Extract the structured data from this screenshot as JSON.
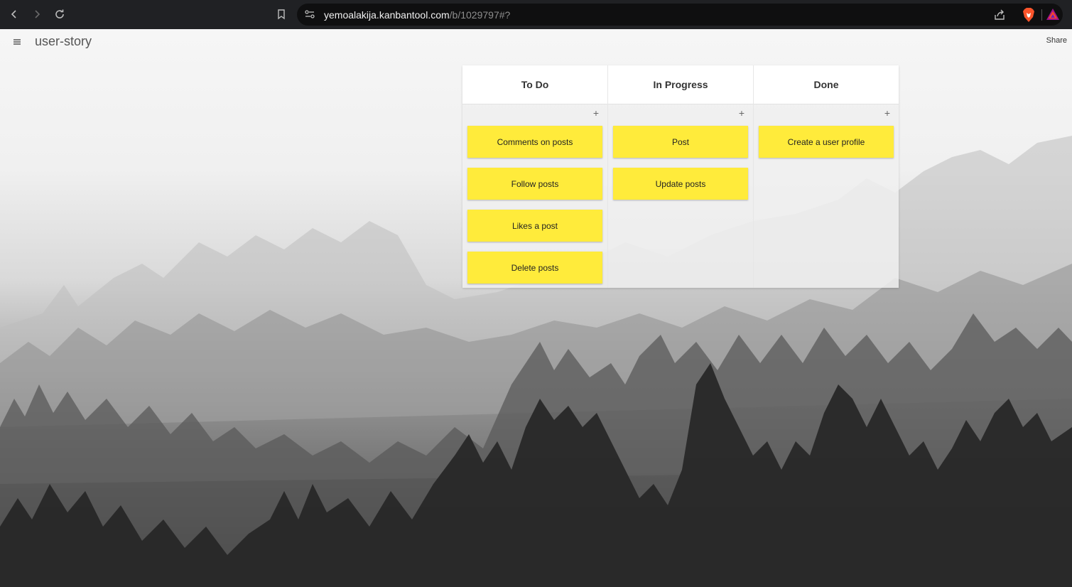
{
  "browser": {
    "url_host": "yemoalakija.kanbantool.com",
    "url_path": "/b/1029797#?"
  },
  "app": {
    "board_title": "user-story",
    "share_label": "Share"
  },
  "board": {
    "columns": [
      {
        "title": "To Do",
        "add_label": "+",
        "cards": [
          "Comments on posts",
          "Follow posts",
          "Likes a post",
          "Delete posts"
        ]
      },
      {
        "title": "In Progress",
        "add_label": "+",
        "cards": [
          "Post",
          "Update posts"
        ]
      },
      {
        "title": "Done",
        "add_label": "+",
        "cards": [
          "Create a user profile"
        ]
      }
    ]
  },
  "colors": {
    "card": "#ffeb3b",
    "chrome": "#202124"
  }
}
